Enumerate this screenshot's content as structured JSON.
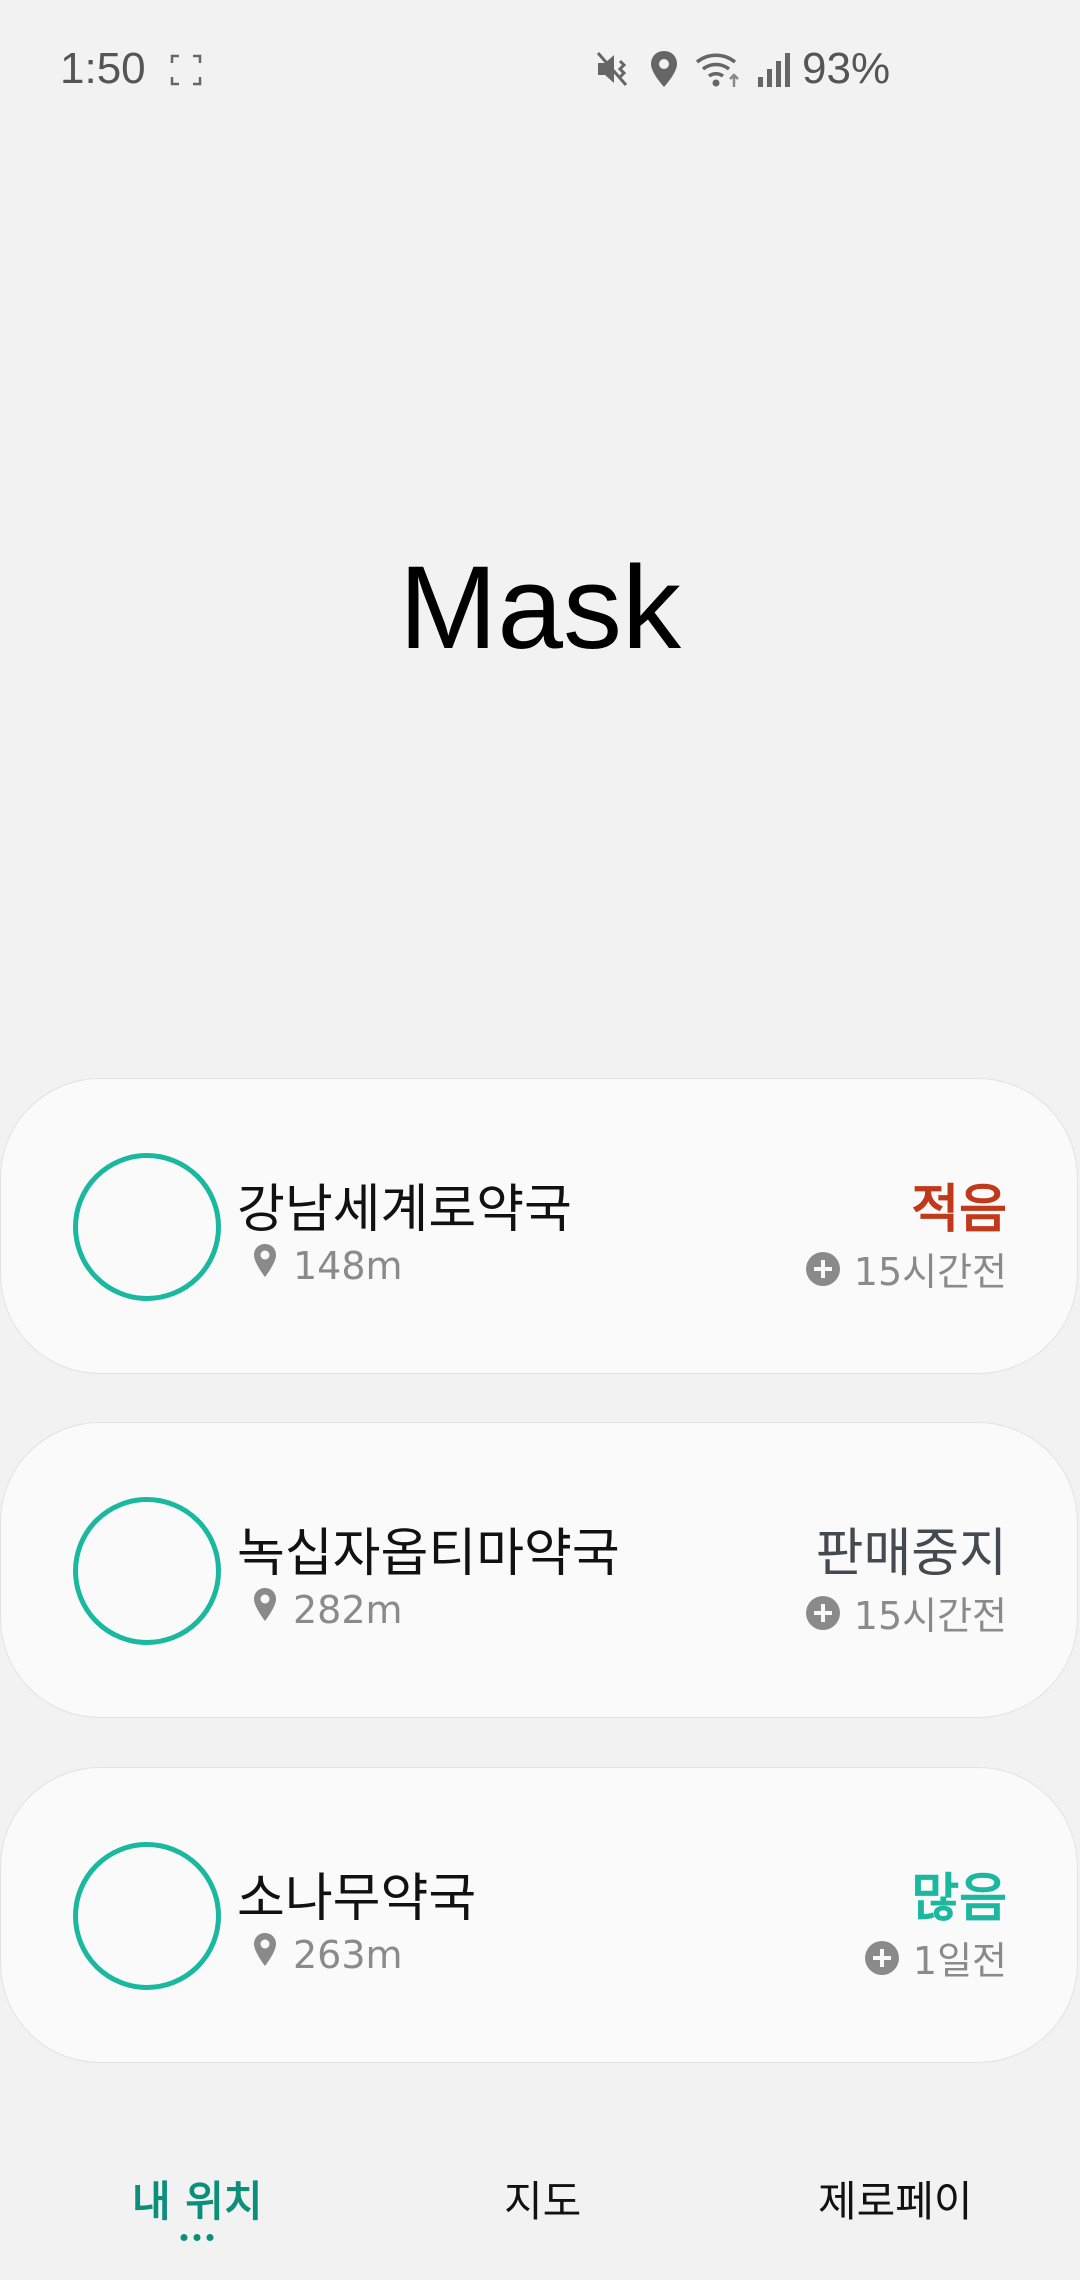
{
  "status_bar": {
    "time": "1:50",
    "battery": "93%",
    "icons": [
      "screenshot-icon",
      "mute-icon",
      "location-icon",
      "wifi-icon",
      "signal-icon"
    ]
  },
  "title": "Mask",
  "colors": {
    "accent": "#1bb8a0",
    "status_low": "#c0391b",
    "status_stopped": "#444a52",
    "status_plenty": "#1bb8a0",
    "nav_active": "#0b8f7a"
  },
  "pharmacies": [
    {
      "name": "강남세계로약국",
      "distance": "148m",
      "status": "적음",
      "status_color": "#c0391b",
      "updated": "15시간전"
    },
    {
      "name": "녹십자옵티마약국",
      "distance": "282m",
      "status": "판매중지",
      "status_color": "#444a52",
      "updated": "15시간전"
    },
    {
      "name": "소나무약국",
      "distance": "263m",
      "status": "많음",
      "status_color": "#1bb8a0",
      "updated": "1일전"
    }
  ],
  "nav": {
    "items": [
      {
        "label": "내 위치",
        "active": true
      },
      {
        "label": "지도",
        "active": false
      },
      {
        "label": "제로페이",
        "active": false
      }
    ]
  }
}
